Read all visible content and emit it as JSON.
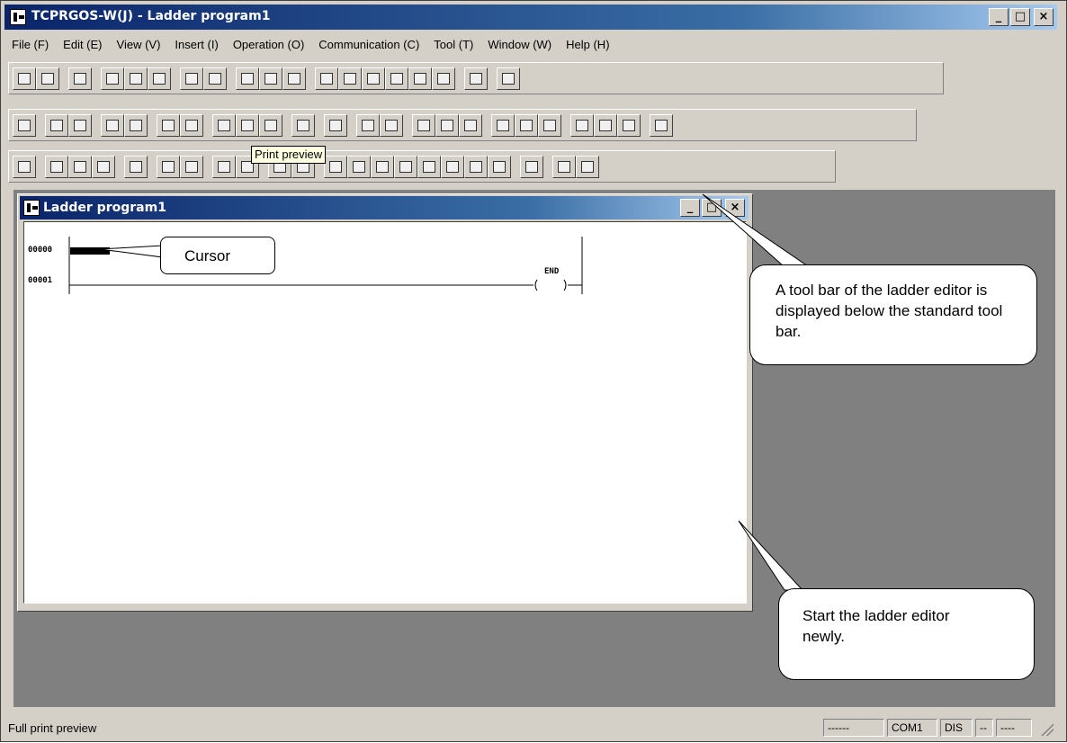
{
  "window": {
    "title": "TCPRGOS-W(J) - Ladder program1",
    "min_label": "_",
    "max_label": "□",
    "close_label": "×"
  },
  "menu": [
    {
      "label": "File (F)"
    },
    {
      "label": "Edit (E)"
    },
    {
      "label": "View (V)"
    },
    {
      "label": "Insert (I)"
    },
    {
      "label": "Operation (O)"
    },
    {
      "label": "Communication (C)"
    },
    {
      "label": "Tool (T)"
    },
    {
      "label": "Window (W)"
    },
    {
      "label": "Help (H)"
    }
  ],
  "toolbar_buttons": {
    "standard": [
      "new-icon",
      "open-icon",
      "write-icon",
      "transfer-icon",
      "compare-icon",
      "verify-icon",
      "run-icon",
      "stop-icon",
      "lightning-icon",
      "unlink-icon",
      "edit-properties-icon",
      "module-icon",
      "reg-icon",
      "link-icon",
      "rio-icon",
      "hash-icon",
      "error-icon",
      "help-icon",
      "mps-icon"
    ],
    "ladder": [
      "cut-icon",
      "mark-icon",
      "marked-icon",
      "search-icon",
      "edit-icon",
      "print-icon",
      "print-preview-icon",
      "find-icon",
      "find-up-icon",
      "find-down-icon",
      "block-icon",
      "comment-icon",
      "dec-icon",
      "hex-icon",
      "zoom-4-icon",
      "zoom-6-icon",
      "zoom-8-icon",
      "dmt-icon",
      "tag-1-icon",
      "tag-2-icon",
      "tag-4-icon",
      "on-icon",
      "off-icon",
      "count-icon"
    ],
    "edit": [
      "save-icon",
      "cut-icon",
      "copy-icon",
      "paste-icon",
      "pencil-icon",
      "insert-row-icon",
      "branch-icon",
      "vertical-line-icon",
      "split-icon",
      "coil-icon",
      "parallel-icon",
      "contact-1-icon",
      "contact-2-icon",
      "contact-3-icon",
      "contact-4-icon",
      "contact-5-icon",
      "contact-6-icon",
      "contact-7-icon",
      "contact-8-icon",
      "function-icon",
      "refresh-icon",
      "grid-icon"
    ]
  },
  "tooltip": "Print preview",
  "child_window": {
    "title": "Ladder program1",
    "min_label": "_",
    "max_label": "□",
    "close_label": "×"
  },
  "ladder": {
    "step_0": "00000",
    "step_1": "00001",
    "end_label": "END"
  },
  "callouts": {
    "cursor": "Cursor",
    "toolbar_note": "A tool bar of the ladder editor is displayed below the standard tool bar.",
    "start_note": "Start the ladder editor newly."
  },
  "status": {
    "text": "Full print preview",
    "pane1": "------",
    "pane2": "COM1",
    "pane3": "DIS",
    "pane4": "--",
    "pane5": "----"
  },
  "colors": {
    "title_bar": "#0a246a",
    "face": "#d4d0c8",
    "mdi_background": "#808080"
  }
}
